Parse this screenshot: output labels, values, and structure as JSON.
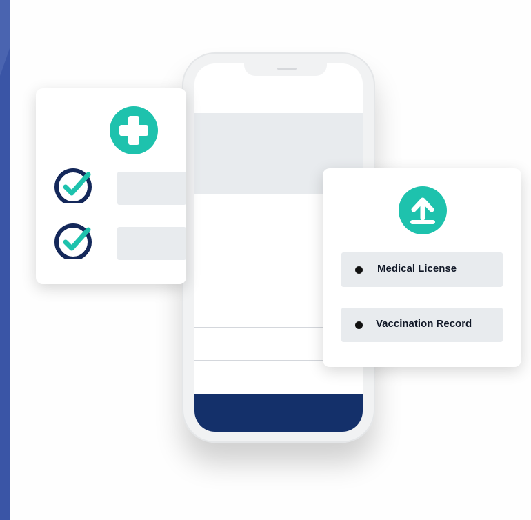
{
  "colors": {
    "accent": "#1ec2ad",
    "navy": "#14306a",
    "check_ring": "#14285a",
    "background_frame": "#4a64b0"
  },
  "left_card": {
    "icon": "medical-cross-icon",
    "check_items": [
      {
        "icon": "check-circle-icon"
      },
      {
        "icon": "check-circle-icon"
      }
    ]
  },
  "right_card": {
    "icon": "upload-icon",
    "documents": [
      {
        "label": "Medical License"
      },
      {
        "label": "Vaccination Record"
      }
    ]
  }
}
